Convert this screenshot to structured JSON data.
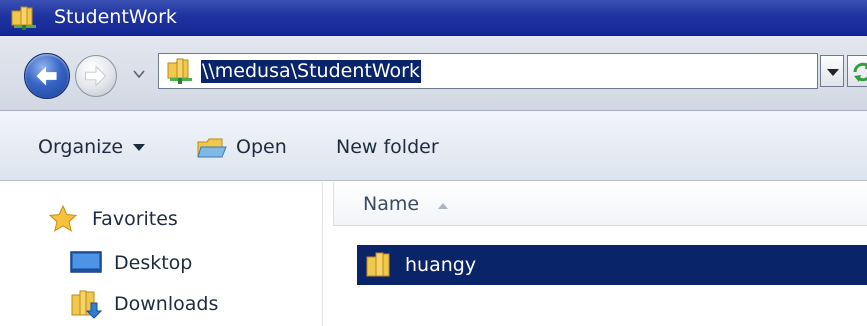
{
  "window": {
    "title": "StudentWork"
  },
  "address": {
    "path": "\\\\medusa\\StudentWork"
  },
  "toolbar": {
    "organize_label": "Organize",
    "open_label": "Open",
    "new_folder_label": "New folder"
  },
  "nav_pane": {
    "items": [
      {
        "label": "Favorites",
        "icon": "star-icon"
      },
      {
        "label": "Desktop",
        "icon": "desktop-icon"
      },
      {
        "label": "Downloads",
        "icon": "downloads-folder-icon"
      }
    ]
  },
  "content": {
    "column_name": "Name",
    "sort": "ascending",
    "files": [
      {
        "name": "huangy",
        "icon": "folder-icon",
        "selected": true
      }
    ]
  },
  "colors": {
    "selection": "#0a246a",
    "titlebar": "#1f33a0",
    "folder_yellow": "#f2c84b"
  }
}
